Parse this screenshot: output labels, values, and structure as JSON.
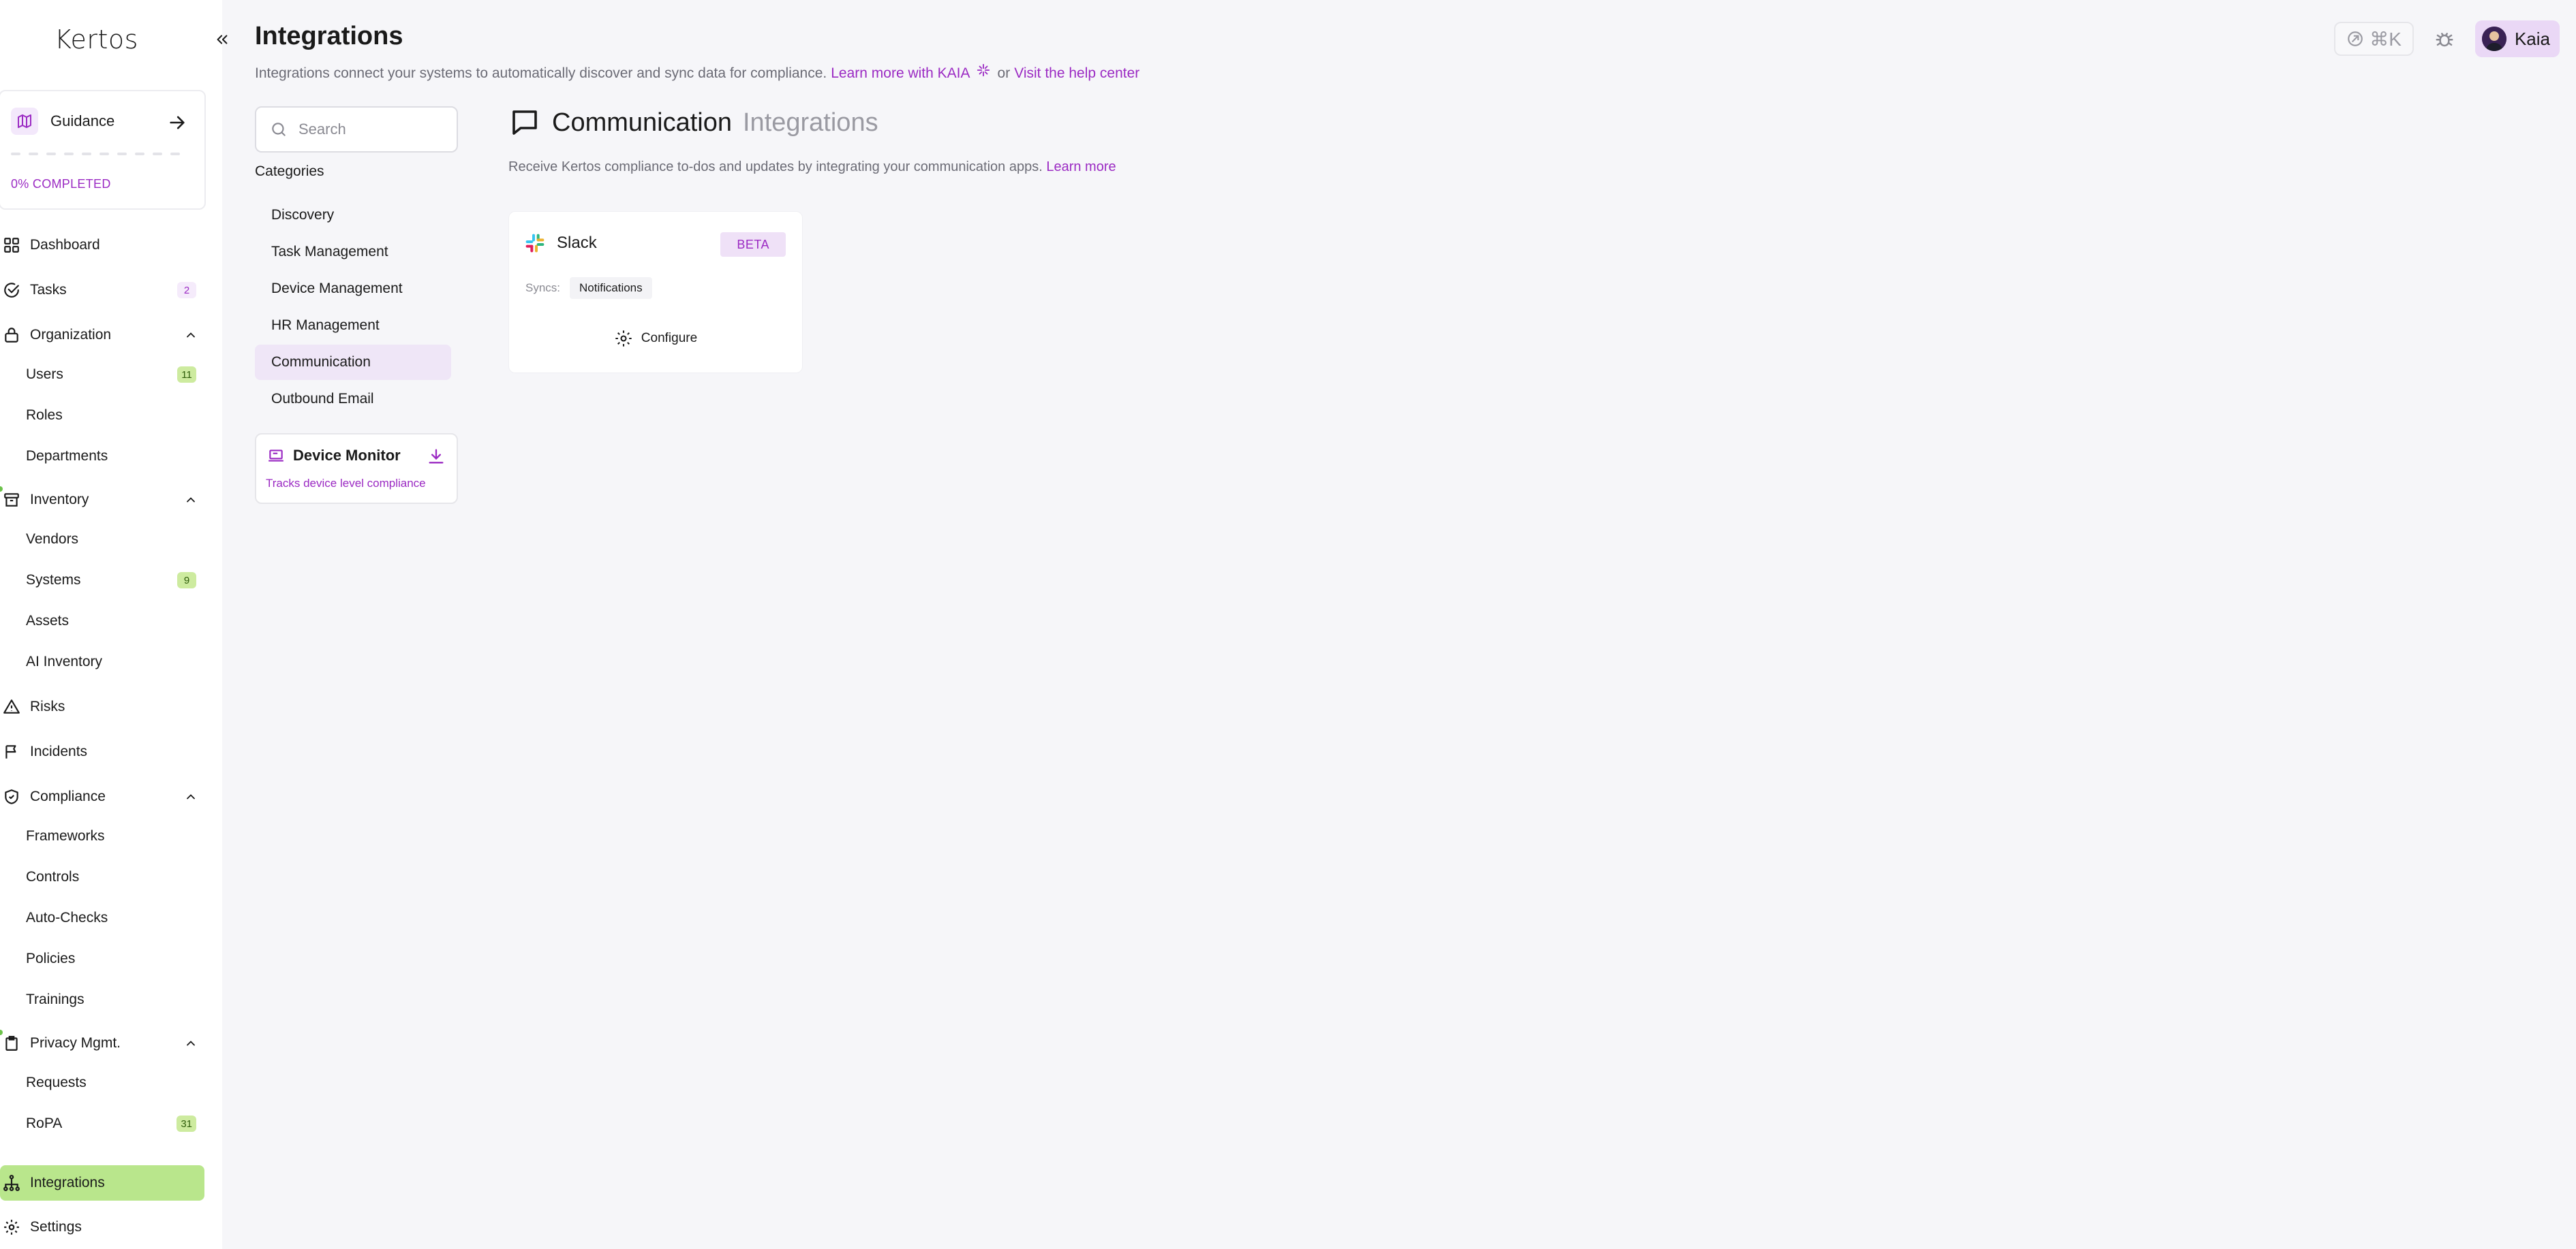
{
  "brand": {
    "logo_text": "Kertos",
    "accent": "#9b2ac3",
    "active_nav_bg": "#b9e68c"
  },
  "sidebar": {
    "guidance": {
      "label": "Guidance",
      "progress_label": "0% COMPLETED",
      "progress": 0
    },
    "items": [
      {
        "label": "Dashboard",
        "icon": "grid-icon"
      },
      {
        "label": "Tasks",
        "icon": "check-circle-icon",
        "badge": "2"
      },
      {
        "label": "Organization",
        "icon": "lock-icon",
        "expanded": true
      },
      {
        "label": "Users",
        "badge": "11"
      },
      {
        "label": "Roles"
      },
      {
        "label": "Departments"
      },
      {
        "label": "Inventory",
        "icon": "archive-icon",
        "expanded": true
      },
      {
        "label": "Vendors"
      },
      {
        "label": "Systems",
        "badge": "9"
      },
      {
        "label": "Assets"
      },
      {
        "label": "AI Inventory"
      },
      {
        "label": "Risks",
        "icon": "warning-icon"
      },
      {
        "label": "Incidents",
        "icon": "flag-icon"
      },
      {
        "label": "Compliance",
        "icon": "shield-check-icon",
        "expanded": true
      },
      {
        "label": "Frameworks"
      },
      {
        "label": "Controls"
      },
      {
        "label": "Auto-Checks"
      },
      {
        "label": "Policies"
      },
      {
        "label": "Trainings"
      },
      {
        "label": "Privacy Mgmt.",
        "icon": "clipboard-icon",
        "expanded": true
      },
      {
        "label": "Requests"
      },
      {
        "label": "RoPA",
        "badge": "31"
      },
      {
        "label": "Integrations",
        "icon": "hierarchy-icon",
        "active": true
      },
      {
        "label": "Settings",
        "icon": "gear-icon"
      }
    ]
  },
  "header": {
    "title": "Integrations",
    "subtitle": "Integrations connect your systems to automatically discover and sync data for compliance.",
    "kaia_link": "Learn more with KAIA",
    "or_text": "or",
    "help_link": "Visit the help center",
    "shortcut": "⌘K",
    "user_name": "Kaia"
  },
  "filters": {
    "search_placeholder": "Search",
    "categories_heading": "Categories",
    "categories": [
      "Discovery",
      "Task Management",
      "Device Management",
      "HR Management",
      "Communication",
      "Outbound Email"
    ],
    "active_category": "Communication",
    "device_monitor": {
      "title": "Device Monitor",
      "description": "Tracks device level compliance"
    }
  },
  "content": {
    "title": "Communication",
    "title_suffix": "Integrations",
    "description": "Receive Kertos compliance to-dos and updates by integrating your communication apps.",
    "description_link": "Learn more",
    "integrations": [
      {
        "name": "Slack",
        "badge": "BETA",
        "syncs_label": "Syncs:",
        "syncs": [
          "Notifications"
        ],
        "action": "Configure"
      }
    ]
  }
}
